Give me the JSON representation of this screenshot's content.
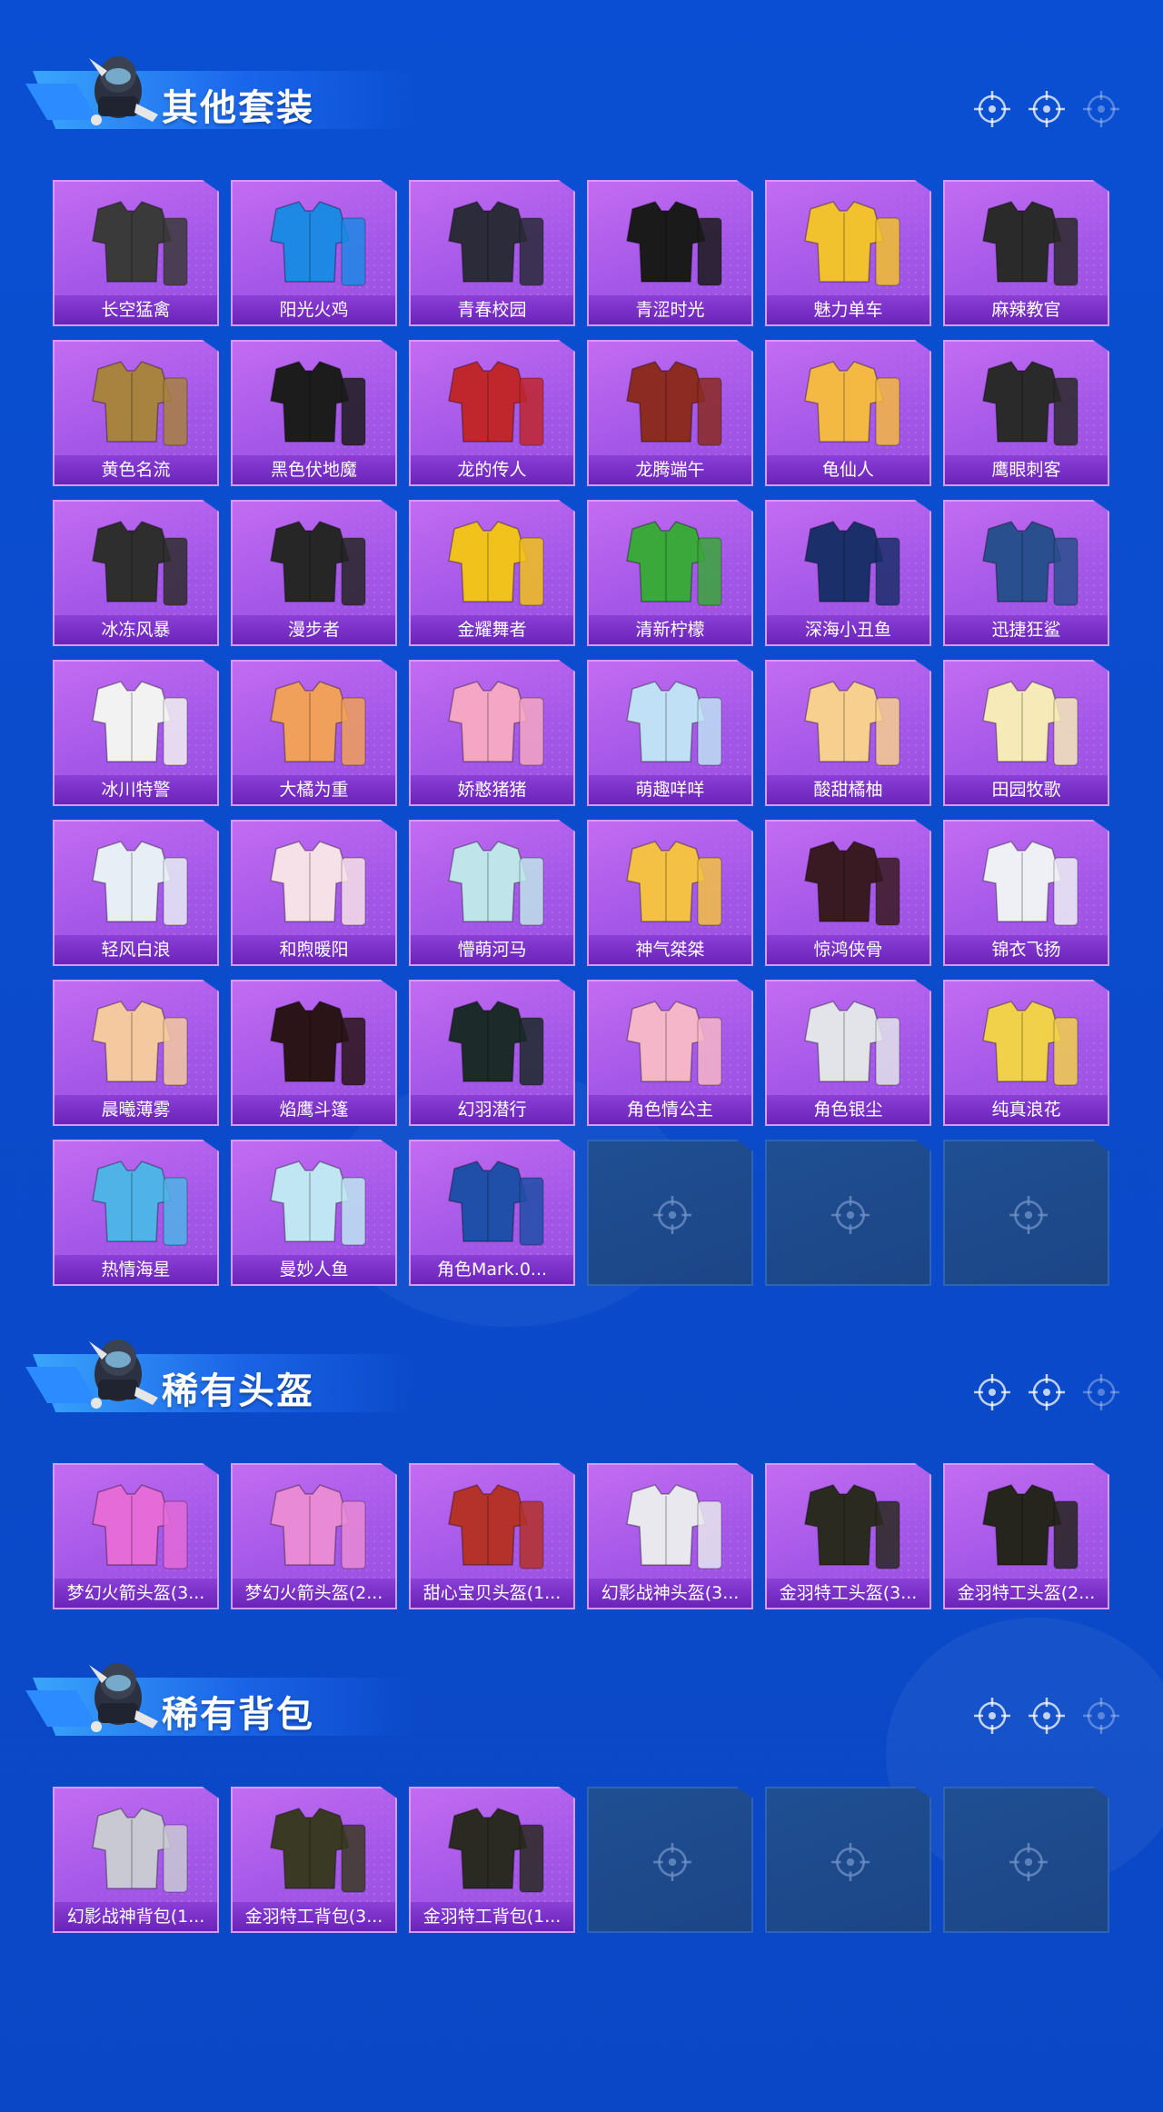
{
  "sections": [
    {
      "title": "其他套装",
      "items": [
        {
          "label": "长空猛禽",
          "color": "#3a3a3a"
        },
        {
          "label": "阳光火鸡",
          "color": "#1e88e5"
        },
        {
          "label": "青春校园",
          "color": "#2b2b3a"
        },
        {
          "label": "青涩时光",
          "color": "#1a1a1a"
        },
        {
          "label": "魅力单车",
          "color": "#f2c12e"
        },
        {
          "label": "麻辣教官",
          "color": "#2a2a2a"
        },
        {
          "label": "黄色名流",
          "color": "#a8823f"
        },
        {
          "label": "黑色伏地魔",
          "color": "#1c1c1c"
        },
        {
          "label": "龙的传人",
          "color": "#c0272d"
        },
        {
          "label": "龙腾端午",
          "color": "#8b2b22"
        },
        {
          "label": "龟仙人",
          "color": "#f4b942"
        },
        {
          "label": "鹰眼刺客",
          "color": "#2a2a2a"
        },
        {
          "label": "冰冻风暴",
          "color": "#2e2e2e"
        },
        {
          "label": "漫步者",
          "color": "#262626"
        },
        {
          "label": "金耀舞者",
          "color": "#f1c21b"
        },
        {
          "label": "清新柠檬",
          "color": "#3aa83a"
        },
        {
          "label": "深海小丑鱼",
          "color": "#1b2f6b"
        },
        {
          "label": "迅捷狂鲨",
          "color": "#2a4f8e"
        },
        {
          "label": "冰川特警",
          "color": "#f2f2f2"
        },
        {
          "label": "大橘为重",
          "color": "#f0a05a"
        },
        {
          "label": "娇憨猪猪",
          "color": "#f4a6c4"
        },
        {
          "label": "萌趣咩咩",
          "color": "#bfe0f5"
        },
        {
          "label": "酸甜橘柚",
          "color": "#f7cf8f"
        },
        {
          "label": "田园牧歌",
          "color": "#f5eab8"
        },
        {
          "label": "轻风白浪",
          "color": "#e8eef5"
        },
        {
          "label": "和煦暖阳",
          "color": "#f7e1e8"
        },
        {
          "label": "懵萌河马",
          "color": "#bfe4ea"
        },
        {
          "label": "神气桀桀",
          "color": "#f4c144"
        },
        {
          "label": "惊鸿侠骨",
          "color": "#3a1a22"
        },
        {
          "label": "锦衣飞扬",
          "color": "#eef0f5"
        },
        {
          "label": "晨曦薄雾",
          "color": "#f4c9a0"
        },
        {
          "label": "焰鹰斗篷",
          "color": "#2a1418"
        },
        {
          "label": "幻羽潜行",
          "color": "#1c2a2a"
        },
        {
          "label": "角色情公主",
          "color": "#f6b6c9"
        },
        {
          "label": "角色银尘",
          "color": "#e2e4ea"
        },
        {
          "label": "纯真浪花",
          "color": "#f2d14a"
        },
        {
          "label": "热情海星",
          "color": "#4fb3e8"
        },
        {
          "label": "曼妙人鱼",
          "color": "#bfe6f2"
        },
        {
          "label": "角色Mark.0...",
          "color": "#1f4fa8"
        }
      ],
      "empty_slots": 3
    },
    {
      "title": "稀有头盔",
      "items": [
        {
          "label": "梦幻火箭头盔(3...",
          "color": "#e46bd8"
        },
        {
          "label": "梦幻火箭头盔(2...",
          "color": "#e98ad6"
        },
        {
          "label": "甜心宝贝头盔(1...",
          "color": "#b5322a"
        },
        {
          "label": "幻影战神头盔(3...",
          "color": "#e8e8ee"
        },
        {
          "label": "金羽特工头盔(3...",
          "color": "#2a2a20"
        },
        {
          "label": "金羽特工头盔(2...",
          "color": "#25251e"
        }
      ],
      "empty_slots": 0
    },
    {
      "title": "稀有背包",
      "items": [
        {
          "label": "幻影战神背包(1...",
          "color": "#c9c9d4"
        },
        {
          "label": "金羽特工背包(3...",
          "color": "#3a3a24"
        },
        {
          "label": "金羽特工背包(1...",
          "color": "#2a2a22"
        }
      ],
      "empty_slots": 3
    }
  ]
}
